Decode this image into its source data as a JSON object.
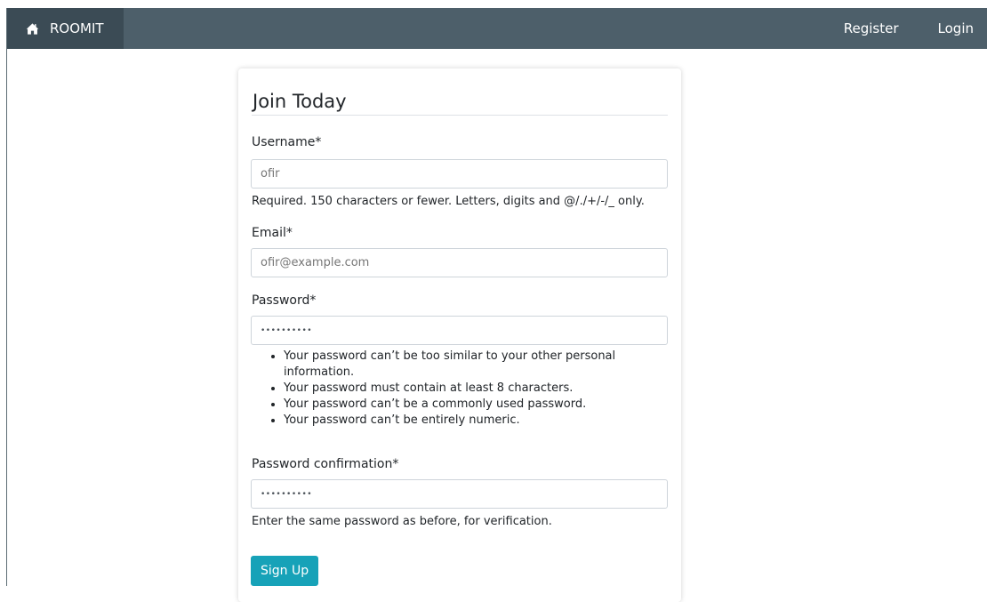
{
  "navbar": {
    "brand": "ROOMIT",
    "brand_icon": "home-icon",
    "links": {
      "register": "Register",
      "login": "Login"
    },
    "colors": {
      "bar": "#4d5f6a",
      "brand_bg": "#3b4b55"
    }
  },
  "form": {
    "legend": "Join Today",
    "username": {
      "label": "Username*",
      "placeholder": "ofir",
      "help": "Required. 150 characters or fewer. Letters, digits and @/./+/-/_ only."
    },
    "email": {
      "label": "Email*",
      "placeholder": "ofir@example.com"
    },
    "password": {
      "label": "Password*",
      "value": "••••••••••",
      "help_items": [
        "Your password can’t be too similar to your other personal information.",
        "Your password must contain at least 8 characters.",
        "Your password can’t be a commonly used password.",
        "Your password can’t be entirely numeric."
      ]
    },
    "password_confirmation": {
      "label": "Password confirmation*",
      "value": "••••••••••",
      "help": "Enter the same password as before, for verification."
    },
    "submit_label": "Sign Up",
    "submit_color": "#17a2b8"
  }
}
